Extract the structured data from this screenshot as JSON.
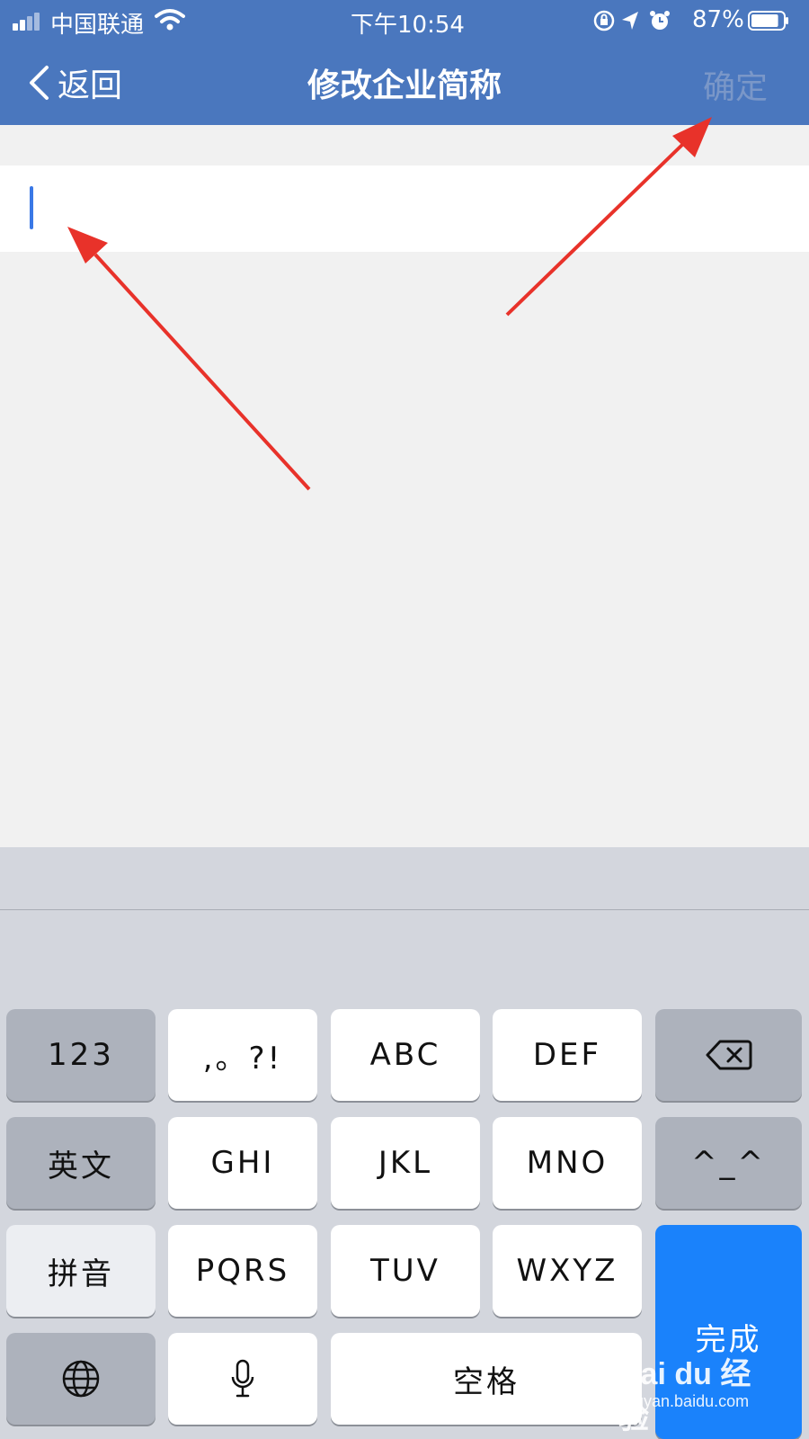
{
  "status_bar": {
    "carrier": "中国联通",
    "time": "下午10:54",
    "battery_percent": "87%",
    "battery_level": 0.87,
    "icons": [
      "signal-icon",
      "wifi-icon",
      "rotation-lock-icon",
      "location-icon",
      "alarm-icon",
      "battery-icon"
    ]
  },
  "nav": {
    "back_label": "返回",
    "title": "修改企业简称",
    "confirm_label": "确定"
  },
  "input": {
    "value": "",
    "placeholder": ""
  },
  "keyboard": {
    "keys": {
      "num": "123",
      "punct": ",。?!",
      "abc": "ABC",
      "def": "DEF",
      "english": "英文",
      "ghi": "GHI",
      "jkl": "JKL",
      "mno": "MNO",
      "emoticon": "^_^",
      "pinyin": "拼音",
      "pqrs": "PQRS",
      "tuv": "TUV",
      "wxyz": "WXYZ",
      "space": "空格",
      "done": "完成"
    }
  },
  "watermark": {
    "logo": "Bai du 经验",
    "url": "jingyan.baidu.com"
  },
  "colors": {
    "header": "#4a77be",
    "confirm_disabled": "#7a97c8",
    "caret": "#3a78e6",
    "done_key": "#1a82fb",
    "arrow": "#e8322a"
  }
}
